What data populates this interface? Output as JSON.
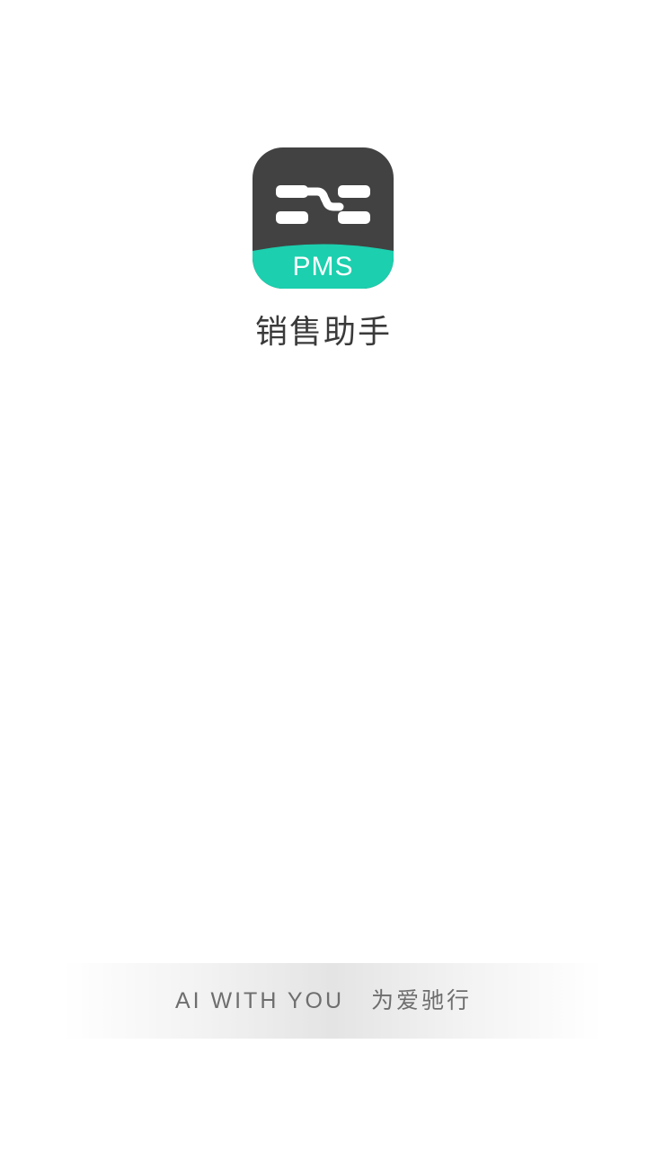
{
  "app": {
    "logo": {
      "icon": "pms-logo-icon",
      "badge_text": "PMS",
      "colors": {
        "dark": "#424242",
        "accent": "#1ccfae",
        "mark": "#ffffff"
      }
    },
    "name": "销售助手"
  },
  "footer": {
    "slogan_en": "AI WITH YOU",
    "slogan_cn": "为爱驰行"
  }
}
